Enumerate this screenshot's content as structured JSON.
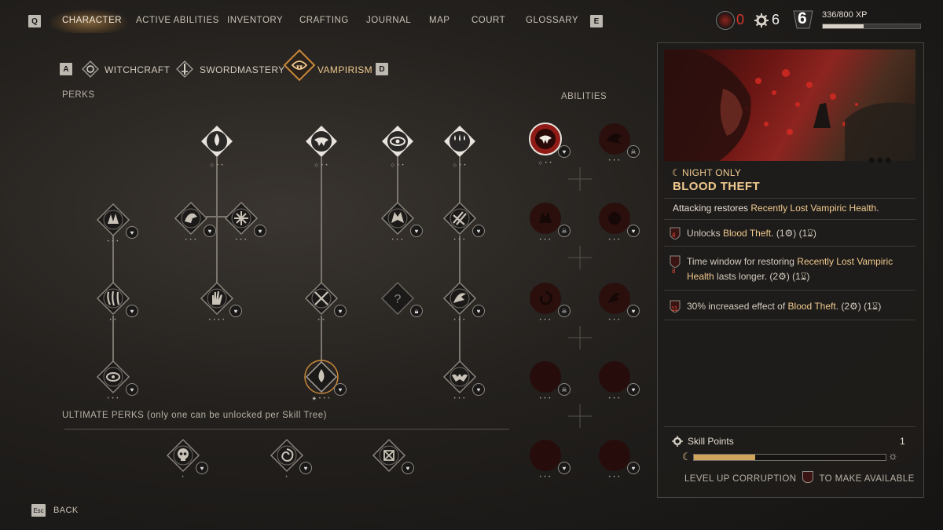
{
  "nav": {
    "left_key": "Q",
    "right_key": "E",
    "tabs": [
      "CHARACTER",
      "ACTIVE ABILITIES",
      "INVENTORY",
      "CRAFTING",
      "JOURNAL",
      "MAP",
      "COURT",
      "GLOSSARY"
    ],
    "active_tab": "CHARACTER"
  },
  "resources": {
    "corruption_count": "0",
    "skill_gear_count": "6",
    "level": "6",
    "xp": "336/800 XP",
    "xp_fraction": 0.42
  },
  "trees": {
    "prev_key": "A",
    "next_key": "D",
    "items": [
      "WITCHCRAFT",
      "SWORDMASTERY",
      "VAMPIRISM"
    ],
    "active": "VAMPIRISM"
  },
  "labels": {
    "perks": "PERKS",
    "abilities": "ABILITIES",
    "ultimate": "ULTIMATE PERKS (only one can be unlocked per Skill Tree)"
  },
  "detail": {
    "tag": "NIGHT ONLY",
    "title": "BLOOD THEFT",
    "desc_prefix": "Attacking restores ",
    "desc_highlight": "Recently Lost Vampiric Health",
    "desc_suffix": ".",
    "upgrades": [
      {
        "level": "4",
        "pre": "Unlocks ",
        "hl": "Blood Theft",
        "post": ". (1",
        "mid": ") (1",
        "end": ")"
      },
      {
        "level": "8",
        "pre": "Time window for restoring ",
        "hl": "Recently Lost Vampiric Health",
        "post2": " lasts longer. (2",
        "mid": ") (1",
        "end": ")"
      },
      {
        "level": "11",
        "pre": "30% increased effect of ",
        "hl": "Blood Theft",
        "post": ". (2",
        "mid": ") (1",
        "end": ")"
      }
    ],
    "skill_points_label": "Skill Points",
    "skill_points_value": "1",
    "corruption_progress": 0.32,
    "footer_pre": "LEVEL UP CORRUPTION",
    "footer_post": "TO MAKE AVAILABLE"
  },
  "bottom": {
    "key": "Esc",
    "label": "BACK"
  },
  "colors": {
    "accent": "#f0c98f",
    "active_ring": "#c8873a",
    "blood": "#8f1a16"
  }
}
